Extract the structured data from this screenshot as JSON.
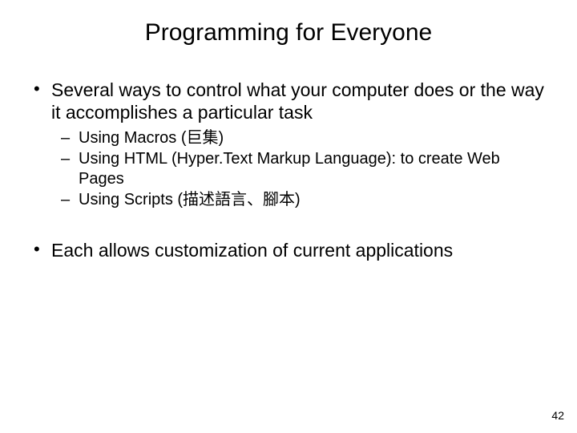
{
  "title": "Programming for Everyone",
  "bullets": {
    "b1": "Several ways to control what your computer does or the way it accomplishes a particular task",
    "sub1": "Using Macros (巨集)",
    "sub2": "Using HTML (Hyper.Text Markup Language): to create Web Pages",
    "sub3": "Using Scripts (描述語言、腳本)",
    "b2": "Each allows customization of current applications"
  },
  "page_number": "42"
}
